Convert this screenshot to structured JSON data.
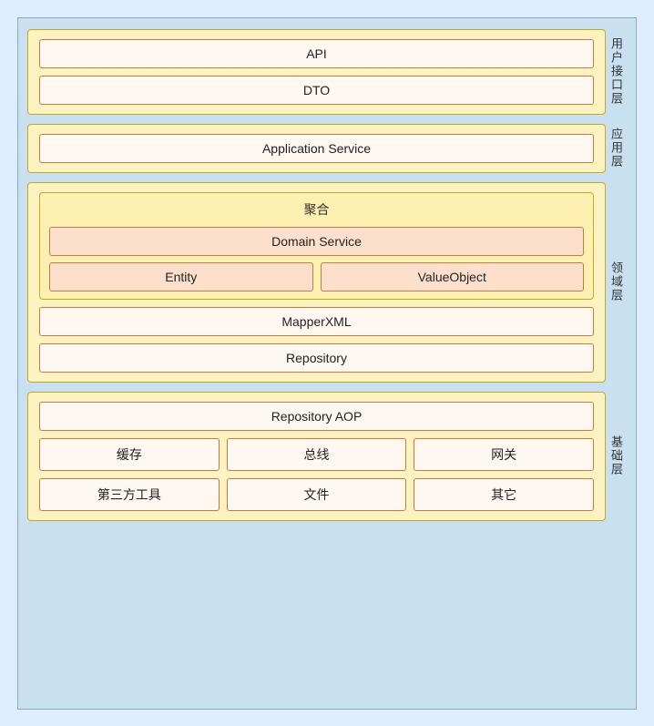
{
  "layers": {
    "ui_layer": {
      "label": "用户接口层",
      "items": [
        "API",
        "DTO"
      ]
    },
    "app_layer": {
      "label": "应用层",
      "items": [
        "Application Service"
      ]
    },
    "domain_layer": {
      "label": "领域层",
      "aggregate_title": "聚合",
      "domain_service": "Domain Service",
      "entity": "Entity",
      "value_object": "ValueObject",
      "mapper_xml": "MapperXML",
      "repository": "Repository"
    },
    "infra_layer": {
      "label": "基础层",
      "repository_aop": "Repository AOP",
      "row1": [
        "缓存",
        "总线",
        "网关"
      ],
      "row2": [
        "第三方工具",
        "文件",
        "其它"
      ]
    }
  }
}
